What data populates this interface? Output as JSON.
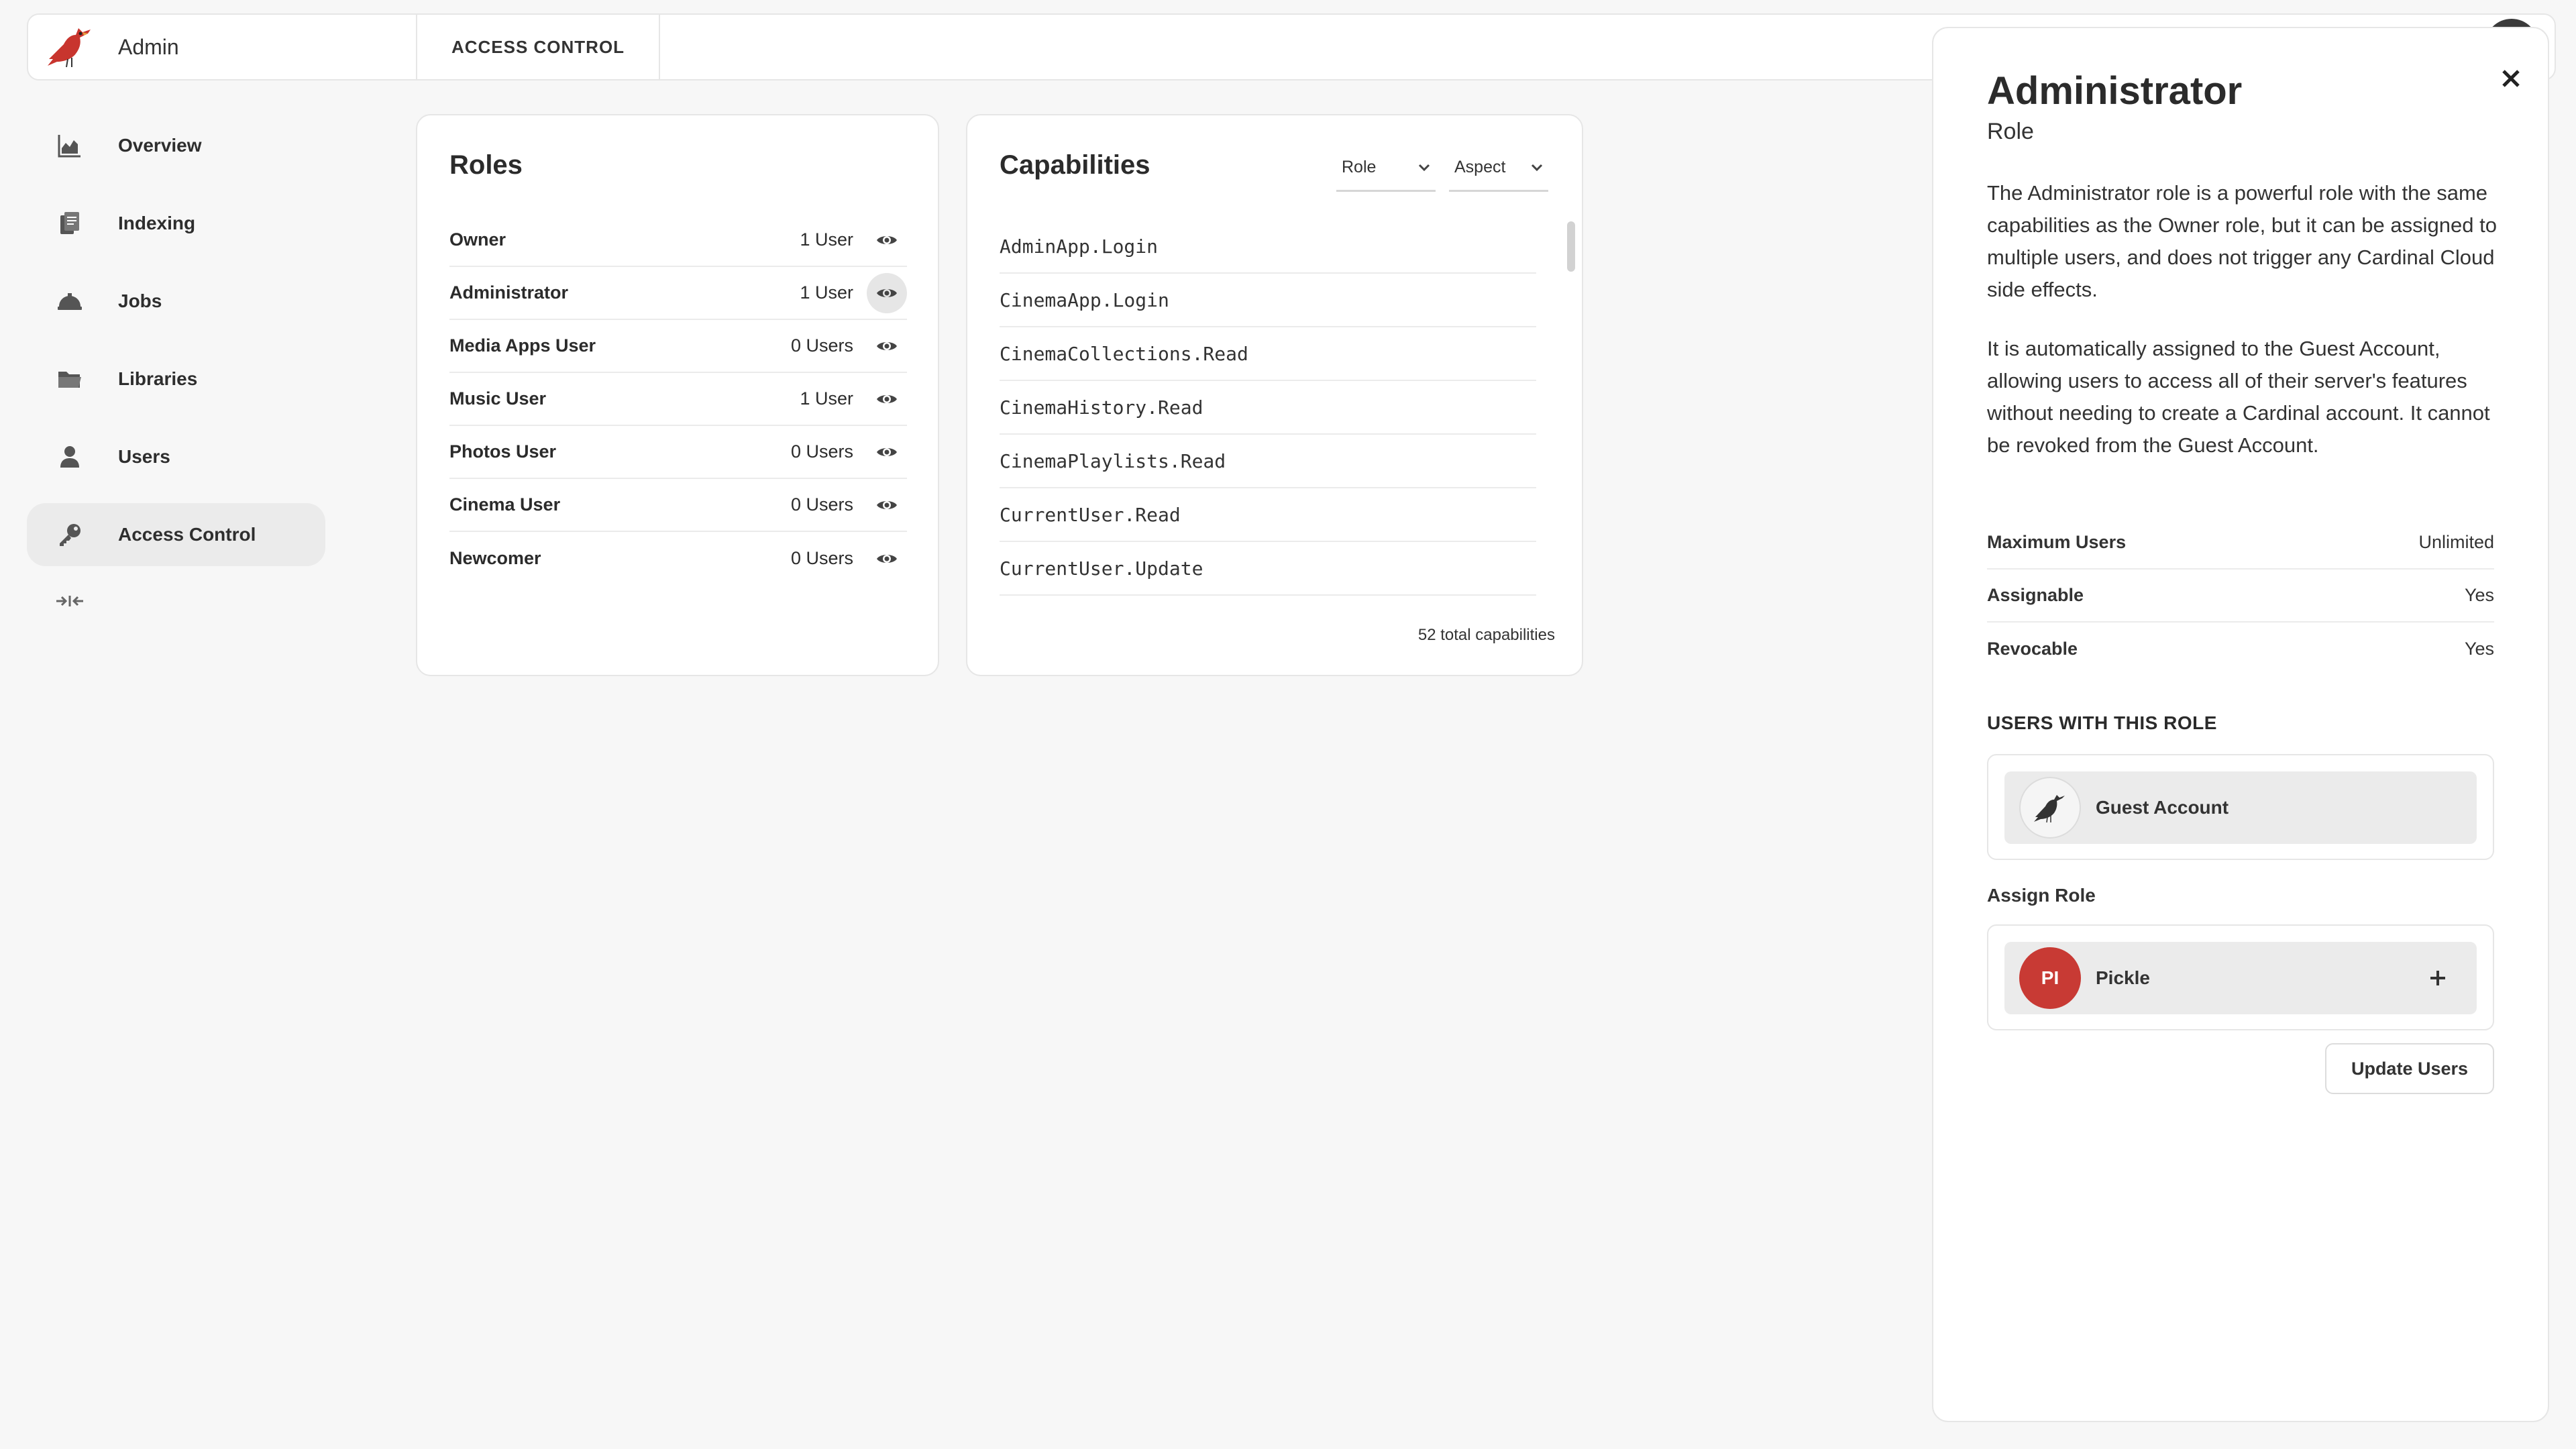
{
  "app": {
    "brand_name": "Admin",
    "active_tab": "ACCESS CONTROL",
    "accent_color": "#c83a34"
  },
  "sidebar": {
    "items": [
      {
        "label": "Overview",
        "icon": "chart-icon"
      },
      {
        "label": "Indexing",
        "icon": "documents-icon"
      },
      {
        "label": "Jobs",
        "icon": "jobs-icon"
      },
      {
        "label": "Libraries",
        "icon": "folder-icon"
      },
      {
        "label": "Users",
        "icon": "user-icon"
      },
      {
        "label": "Access Control",
        "icon": "key-icon",
        "active": true
      }
    ]
  },
  "roles": {
    "title": "Roles",
    "rows": [
      {
        "name": "Owner",
        "count": "1 User"
      },
      {
        "name": "Administrator",
        "count": "1 User",
        "selected": true
      },
      {
        "name": "Media Apps User",
        "count": "0 Users"
      },
      {
        "name": "Music User",
        "count": "1 User"
      },
      {
        "name": "Photos User",
        "count": "0 Users"
      },
      {
        "name": "Cinema User",
        "count": "0 Users"
      },
      {
        "name": "Newcomer",
        "count": "0 Users"
      }
    ]
  },
  "capabilities": {
    "title": "Capabilities",
    "filter_role": "Role",
    "filter_aspect": "Aspect",
    "items": [
      "AdminApp.Login",
      "CinemaApp.Login",
      "CinemaCollections.Read",
      "CinemaHistory.Read",
      "CinemaPlaylists.Read",
      "CurrentUser.Read",
      "CurrentUser.Update"
    ],
    "total": "52 total capabilities"
  },
  "panel": {
    "title": "Administrator",
    "subtitle": "Role",
    "description_1": "The Administrator role is a powerful role with the same capabilities as the Owner role, but it can be assigned to multiple users, and does not trigger any Cardinal Cloud side effects.",
    "description_2": "It is automatically assigned to the Guest Account, allowing users to access all of their server's features without needing to create a Cardinal account. It cannot be revoked from the Guest Account.",
    "properties": [
      {
        "label": "Maximum Users",
        "value": "Unlimited"
      },
      {
        "label": "Assignable",
        "value": "Yes"
      },
      {
        "label": "Revocable",
        "value": "Yes"
      }
    ],
    "users_section_title": "USERS WITH THIS ROLE",
    "users": [
      {
        "name": "Guest Account"
      }
    ],
    "assign_title": "Assign Role",
    "assign_candidates": [
      {
        "name": "Pickle",
        "initials": "PI"
      }
    ],
    "update_button": "Update Users"
  }
}
